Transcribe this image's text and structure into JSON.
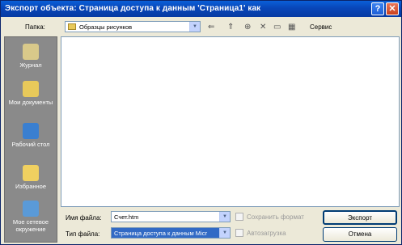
{
  "window": {
    "title": "Экспорт объекта: Страница доступа к данным 'Страница1' как",
    "help_glyph": "?",
    "close_glyph": "✕"
  },
  "toolbar": {
    "folder_label": "Папка:",
    "folder_value": "Образцы рисунков",
    "back_glyph": "⇐",
    "up_glyph": "⇑",
    "search_glyph": "⊕",
    "delete_glyph": "✕",
    "newfolder_glyph": "▭",
    "views_glyph": "▦",
    "tools_label": "Сервис"
  },
  "places": [
    {
      "label": "Журнал",
      "icon": "history-icon",
      "color": "#d9c98a"
    },
    {
      "label": "Мои документы",
      "icon": "my-documents-icon",
      "color": "#e8c95a"
    },
    {
      "label": "Рабочий стол",
      "icon": "desktop-icon",
      "color": "#3a7fd0"
    },
    {
      "label": "Избранное",
      "icon": "favorites-icon",
      "color": "#f0d060"
    },
    {
      "label": "Мое сетевое окружение",
      "icon": "network-icon",
      "color": "#5a9ad8"
    }
  ],
  "form": {
    "filename_label": "Имя файла:",
    "filename_value": "Счет.htm",
    "filetype_label": "Тип файла:",
    "filetype_value": "Страница доступа к данным Micr",
    "save_format_label": "Сохранить формат",
    "autostart_label": "Автозагрузка"
  },
  "buttons": {
    "export_label": "Экспорт",
    "cancel_label": "Отмена"
  }
}
